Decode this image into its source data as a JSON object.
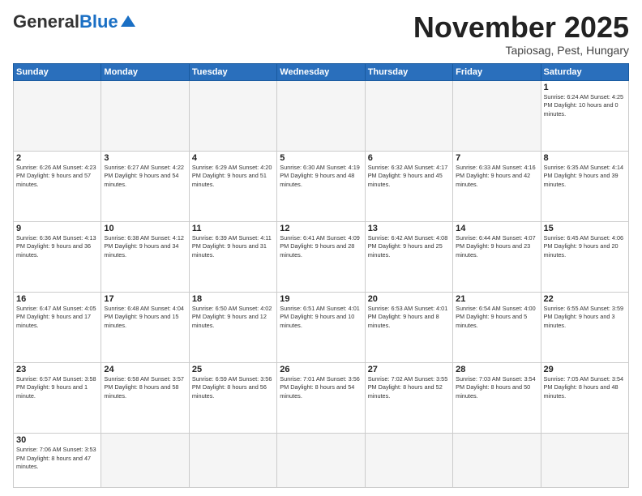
{
  "logo": {
    "general": "General",
    "blue": "Blue"
  },
  "header": {
    "month": "November 2025",
    "location": "Tapiosag, Pest, Hungary"
  },
  "weekdays": [
    "Sunday",
    "Monday",
    "Tuesday",
    "Wednesday",
    "Thursday",
    "Friday",
    "Saturday"
  ],
  "weeks": [
    [
      {
        "day": "",
        "info": ""
      },
      {
        "day": "",
        "info": ""
      },
      {
        "day": "",
        "info": ""
      },
      {
        "day": "",
        "info": ""
      },
      {
        "day": "",
        "info": ""
      },
      {
        "day": "",
        "info": ""
      },
      {
        "day": "1",
        "info": "Sunrise: 6:24 AM\nSunset: 4:25 PM\nDaylight: 10 hours\nand 0 minutes."
      }
    ],
    [
      {
        "day": "2",
        "info": "Sunrise: 6:26 AM\nSunset: 4:23 PM\nDaylight: 9 hours\nand 57 minutes."
      },
      {
        "day": "3",
        "info": "Sunrise: 6:27 AM\nSunset: 4:22 PM\nDaylight: 9 hours\nand 54 minutes."
      },
      {
        "day": "4",
        "info": "Sunrise: 6:29 AM\nSunset: 4:20 PM\nDaylight: 9 hours\nand 51 minutes."
      },
      {
        "day": "5",
        "info": "Sunrise: 6:30 AM\nSunset: 4:19 PM\nDaylight: 9 hours\nand 48 minutes."
      },
      {
        "day": "6",
        "info": "Sunrise: 6:32 AM\nSunset: 4:17 PM\nDaylight: 9 hours\nand 45 minutes."
      },
      {
        "day": "7",
        "info": "Sunrise: 6:33 AM\nSunset: 4:16 PM\nDaylight: 9 hours\nand 42 minutes."
      },
      {
        "day": "8",
        "info": "Sunrise: 6:35 AM\nSunset: 4:14 PM\nDaylight: 9 hours\nand 39 minutes."
      }
    ],
    [
      {
        "day": "9",
        "info": "Sunrise: 6:36 AM\nSunset: 4:13 PM\nDaylight: 9 hours\nand 36 minutes."
      },
      {
        "day": "10",
        "info": "Sunrise: 6:38 AM\nSunset: 4:12 PM\nDaylight: 9 hours\nand 34 minutes."
      },
      {
        "day": "11",
        "info": "Sunrise: 6:39 AM\nSunset: 4:11 PM\nDaylight: 9 hours\nand 31 minutes."
      },
      {
        "day": "12",
        "info": "Sunrise: 6:41 AM\nSunset: 4:09 PM\nDaylight: 9 hours\nand 28 minutes."
      },
      {
        "day": "13",
        "info": "Sunrise: 6:42 AM\nSunset: 4:08 PM\nDaylight: 9 hours\nand 25 minutes."
      },
      {
        "day": "14",
        "info": "Sunrise: 6:44 AM\nSunset: 4:07 PM\nDaylight: 9 hours\nand 23 minutes."
      },
      {
        "day": "15",
        "info": "Sunrise: 6:45 AM\nSunset: 4:06 PM\nDaylight: 9 hours\nand 20 minutes."
      }
    ],
    [
      {
        "day": "16",
        "info": "Sunrise: 6:47 AM\nSunset: 4:05 PM\nDaylight: 9 hours\nand 17 minutes."
      },
      {
        "day": "17",
        "info": "Sunrise: 6:48 AM\nSunset: 4:04 PM\nDaylight: 9 hours\nand 15 minutes."
      },
      {
        "day": "18",
        "info": "Sunrise: 6:50 AM\nSunset: 4:02 PM\nDaylight: 9 hours\nand 12 minutes."
      },
      {
        "day": "19",
        "info": "Sunrise: 6:51 AM\nSunset: 4:01 PM\nDaylight: 9 hours\nand 10 minutes."
      },
      {
        "day": "20",
        "info": "Sunrise: 6:53 AM\nSunset: 4:01 PM\nDaylight: 9 hours\nand 8 minutes."
      },
      {
        "day": "21",
        "info": "Sunrise: 6:54 AM\nSunset: 4:00 PM\nDaylight: 9 hours\nand 5 minutes."
      },
      {
        "day": "22",
        "info": "Sunrise: 6:55 AM\nSunset: 3:59 PM\nDaylight: 9 hours\nand 3 minutes."
      }
    ],
    [
      {
        "day": "23",
        "info": "Sunrise: 6:57 AM\nSunset: 3:58 PM\nDaylight: 9 hours\nand 1 minute."
      },
      {
        "day": "24",
        "info": "Sunrise: 6:58 AM\nSunset: 3:57 PM\nDaylight: 8 hours\nand 58 minutes."
      },
      {
        "day": "25",
        "info": "Sunrise: 6:59 AM\nSunset: 3:56 PM\nDaylight: 8 hours\nand 56 minutes."
      },
      {
        "day": "26",
        "info": "Sunrise: 7:01 AM\nSunset: 3:56 PM\nDaylight: 8 hours\nand 54 minutes."
      },
      {
        "day": "27",
        "info": "Sunrise: 7:02 AM\nSunset: 3:55 PM\nDaylight: 8 hours\nand 52 minutes."
      },
      {
        "day": "28",
        "info": "Sunrise: 7:03 AM\nSunset: 3:54 PM\nDaylight: 8 hours\nand 50 minutes."
      },
      {
        "day": "29",
        "info": "Sunrise: 7:05 AM\nSunset: 3:54 PM\nDaylight: 8 hours\nand 48 minutes."
      }
    ],
    [
      {
        "day": "30",
        "info": "Sunrise: 7:06 AM\nSunset: 3:53 PM\nDaylight: 8 hours\nand 47 minutes."
      },
      {
        "day": "",
        "info": ""
      },
      {
        "day": "",
        "info": ""
      },
      {
        "day": "",
        "info": ""
      },
      {
        "day": "",
        "info": ""
      },
      {
        "day": "",
        "info": ""
      },
      {
        "day": "",
        "info": ""
      }
    ]
  ]
}
